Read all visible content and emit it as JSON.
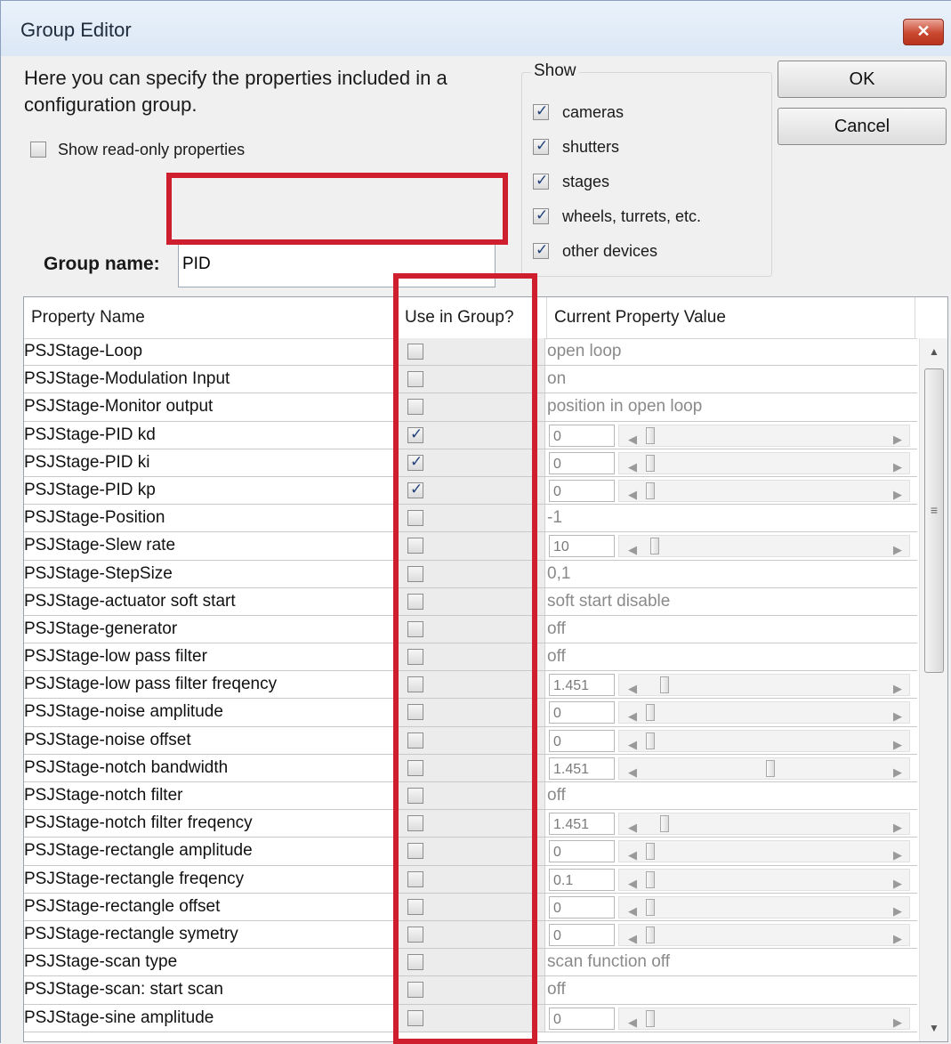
{
  "window": {
    "title": "Group Editor",
    "close_label": "✕"
  },
  "description": "Here you can specify the properties included in a configuration group.",
  "readonly_label": "Show read-only properties",
  "show": {
    "legend": "Show",
    "items": [
      {
        "label": "cameras",
        "checked": true
      },
      {
        "label": "shutters",
        "checked": true
      },
      {
        "label": "stages",
        "checked": true
      },
      {
        "label": "wheels, turrets, etc.",
        "checked": true
      },
      {
        "label": "other devices",
        "checked": true
      }
    ]
  },
  "buttons": {
    "ok": "OK",
    "cancel": "Cancel"
  },
  "group_name": {
    "label": "Group name:",
    "value": "PID"
  },
  "table": {
    "headers": [
      "Property Name",
      "Use in Group?",
      "Current Property Value"
    ],
    "rows": [
      {
        "name": "PSJStage-Loop",
        "use": false,
        "value": "open loop"
      },
      {
        "name": "PSJStage-Modulation Input",
        "use": false,
        "value": "on"
      },
      {
        "name": "PSJStage-Monitor output",
        "use": false,
        "value": "position in open loop"
      },
      {
        "name": "PSJStage-PID kd",
        "use": true,
        "slider": "0",
        "level": 0
      },
      {
        "name": "PSJStage-PID ki",
        "use": true,
        "slider": "0",
        "level": 0
      },
      {
        "name": "PSJStage-PID kp",
        "use": true,
        "slider": "0",
        "level": 0
      },
      {
        "name": "PSJStage-Position",
        "use": false,
        "value": "-1"
      },
      {
        "name": "PSJStage-Slew rate",
        "use": false,
        "slider": "10",
        "level": 0.02
      },
      {
        "name": "PSJStage-StepSize",
        "use": false,
        "value": "0,1"
      },
      {
        "name": "PSJStage-actuator soft start",
        "use": false,
        "value": "soft start disable"
      },
      {
        "name": "PSJStage-generator",
        "use": false,
        "value": "off"
      },
      {
        "name": "PSJStage-low pass filter",
        "use": false,
        "value": "off"
      },
      {
        "name": "PSJStage-low pass filter freqency",
        "use": false,
        "slider": "1.451",
        "level": 0.06
      },
      {
        "name": "PSJStage-noise amplitude",
        "use": false,
        "slider": "0",
        "level": 0
      },
      {
        "name": "PSJStage-noise offset",
        "use": false,
        "slider": "0",
        "level": 0
      },
      {
        "name": "PSJStage-notch bandwidth",
        "use": false,
        "slider": "1.451",
        "level": 0.5
      },
      {
        "name": "PSJStage-notch filter",
        "use": false,
        "value": "off"
      },
      {
        "name": "PSJStage-notch filter freqency",
        "use": false,
        "slider": "1.451",
        "level": 0.06
      },
      {
        "name": "PSJStage-rectangle amplitude",
        "use": false,
        "slider": "0",
        "level": 0
      },
      {
        "name": "PSJStage-rectangle freqency",
        "use": false,
        "slider": "0.1",
        "level": 0
      },
      {
        "name": "PSJStage-rectangle offset",
        "use": false,
        "slider": "0",
        "level": 0
      },
      {
        "name": "PSJStage-rectangle symetry",
        "use": false,
        "slider": "0",
        "level": 0
      },
      {
        "name": "PSJStage-scan type",
        "use": false,
        "value": "scan function off"
      },
      {
        "name": "PSJStage-scan: start scan",
        "use": false,
        "value": "off"
      },
      {
        "name": "PSJStage-sine amplitude",
        "use": false,
        "slider": "0",
        "level": 0
      }
    ]
  },
  "scrollbar": {
    "up": "▲",
    "down": "▼",
    "grip": "≡"
  },
  "highlight_color": "#cf1f2e"
}
